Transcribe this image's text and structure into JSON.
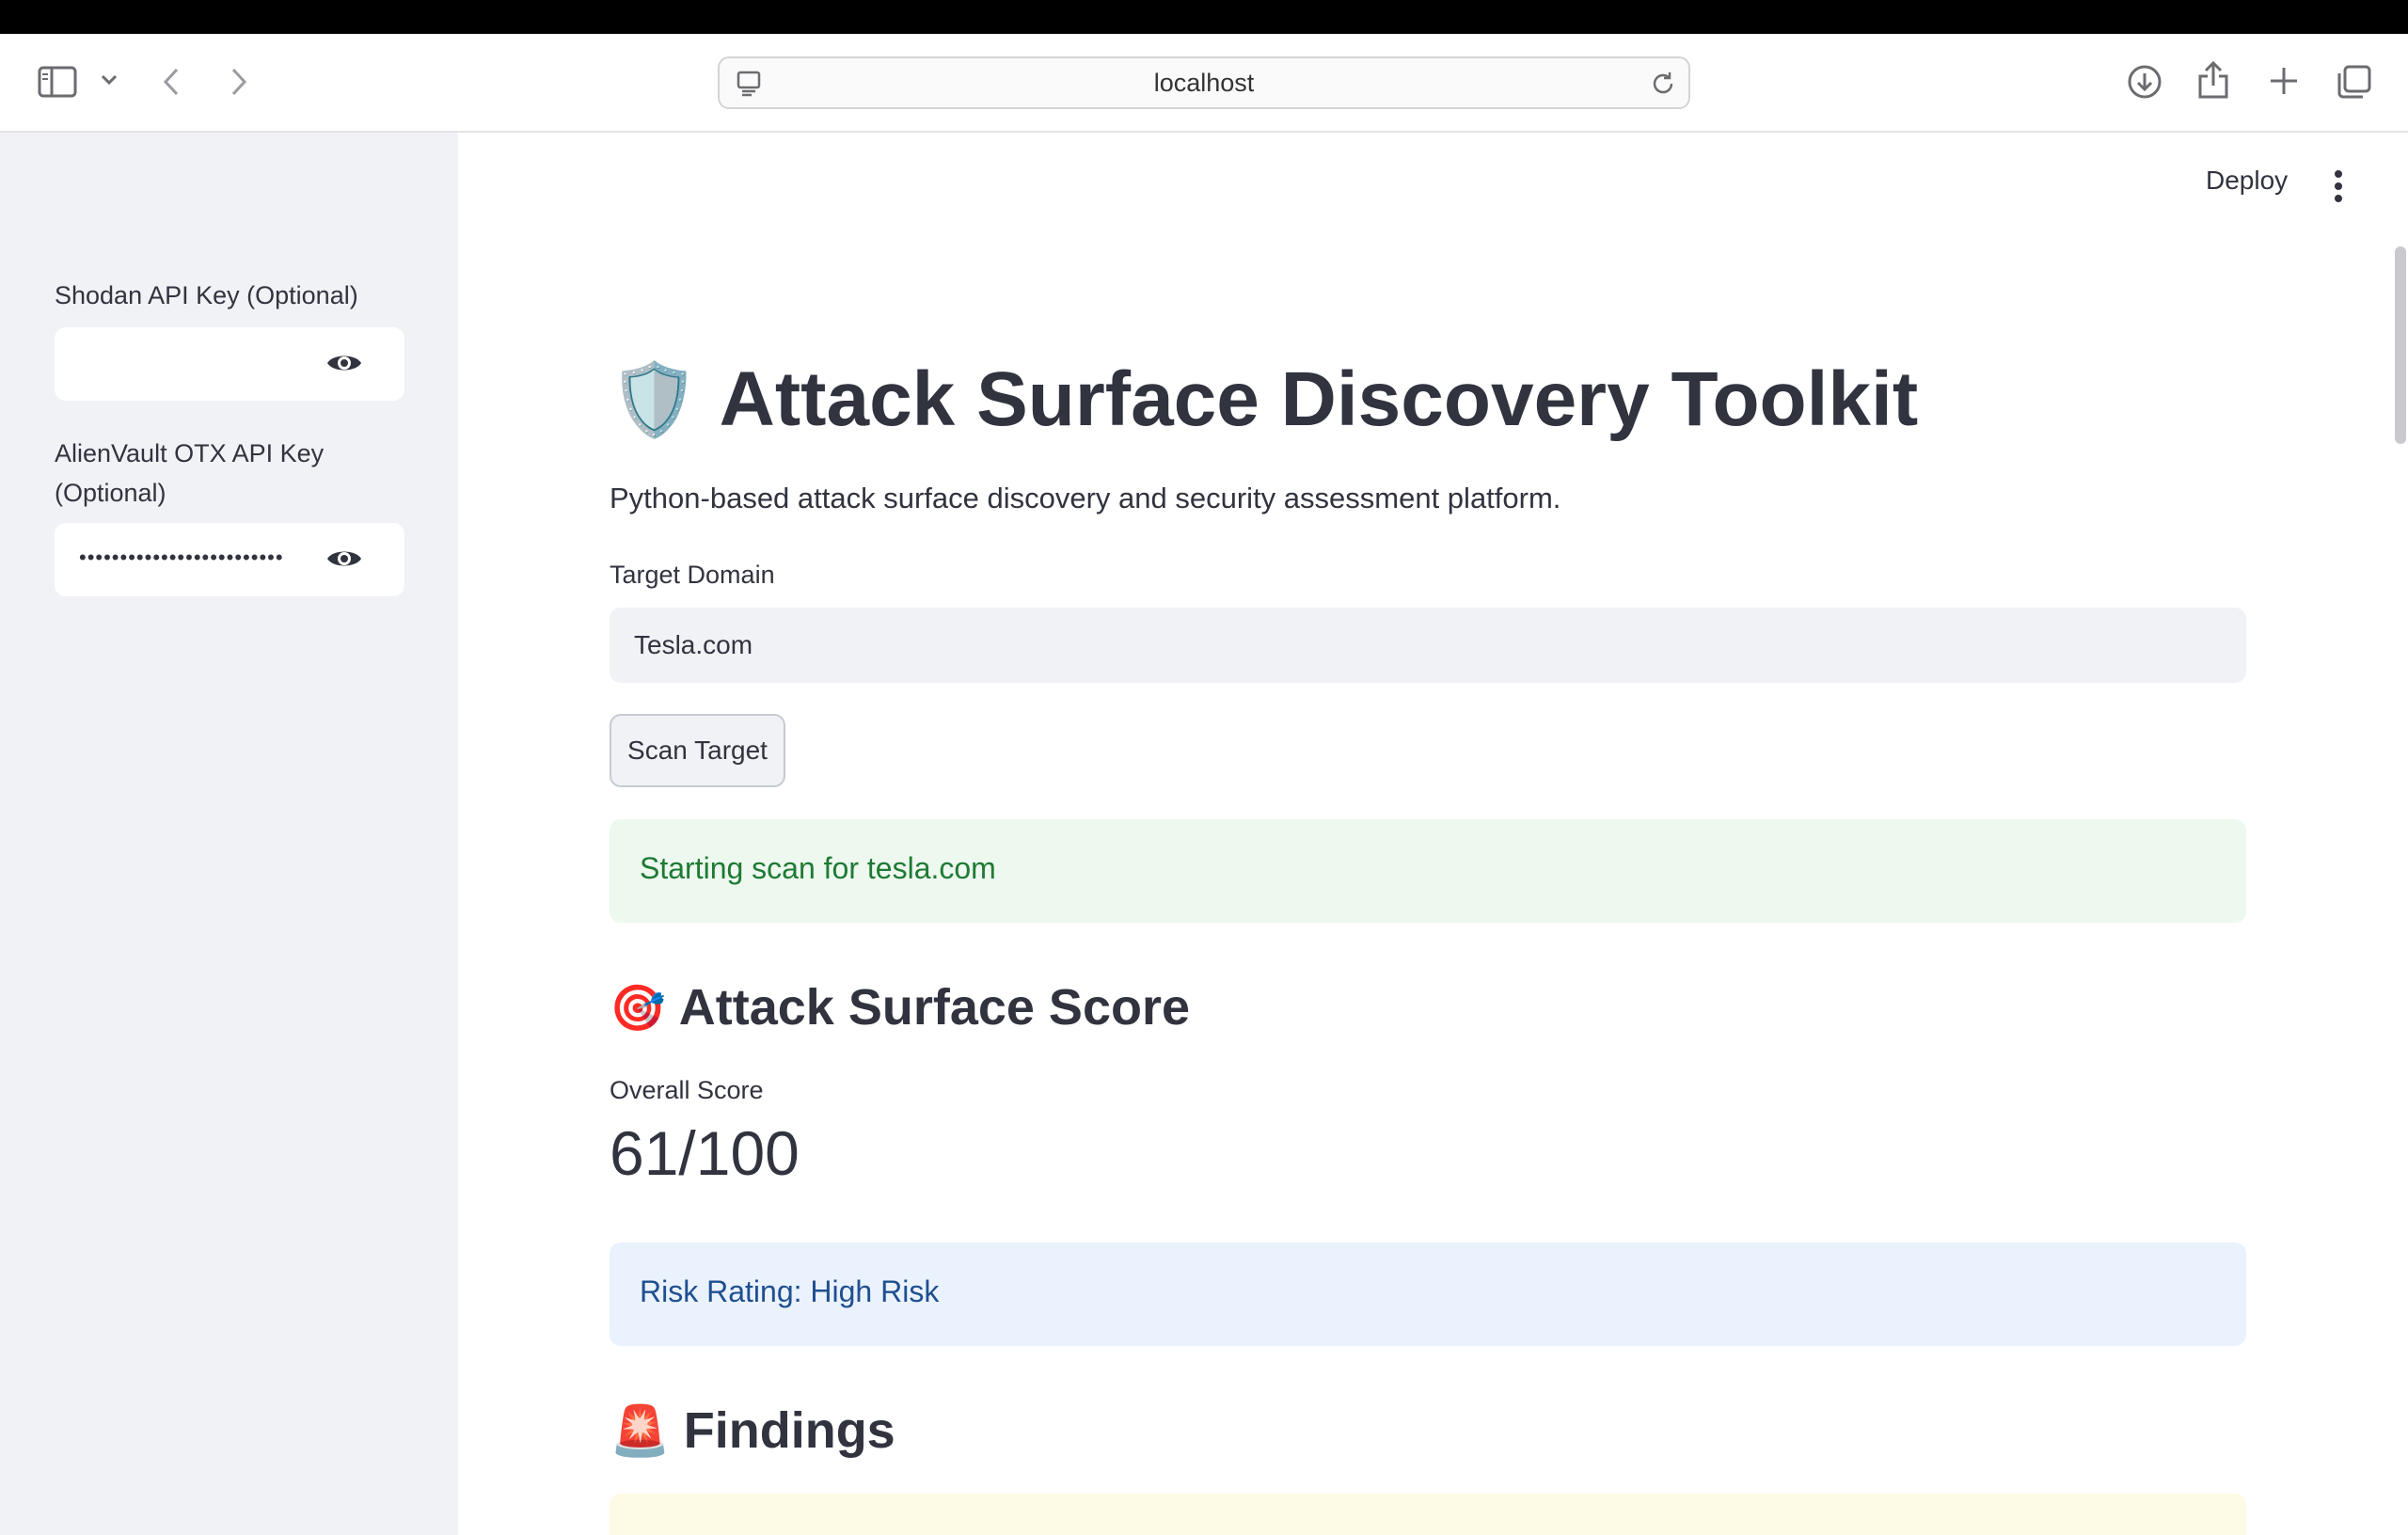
{
  "browser": {
    "url": "localhost",
    "icons": [
      "sidebar-toggle-icon",
      "chevron-down-icon",
      "back-arrow-icon",
      "forward-arrow-icon",
      "site-settings-icon",
      "reload-icon",
      "download-icon",
      "share-icon",
      "new-tab-icon",
      "tab-overview-icon"
    ]
  },
  "sidebar": {
    "shodan": {
      "label": "Shodan API Key (Optional)",
      "value": ""
    },
    "otx": {
      "label_line1": "AlienVault OTX API Key",
      "label_line2": "(Optional)",
      "value": "•••••••••••••••••••••••••"
    }
  },
  "toolbar": {
    "deploy_label": "Deploy"
  },
  "main": {
    "title": "Attack Surface Discovery Toolkit",
    "title_icon": "🛡️",
    "subtitle": "Python-based attack surface discovery and security assessment platform.",
    "target": {
      "label": "Target Domain",
      "value": "Tesla.com"
    },
    "scan_button": "Scan Target",
    "status_message": "Starting scan for tesla.com",
    "score_section": {
      "icon": "🎯",
      "heading": "Attack Surface Score",
      "metric_label": "Overall Score",
      "metric_value": "61/100"
    },
    "risk_message": "Risk Rating: High Risk",
    "findings_section": {
      "icon": "🚨",
      "heading": "Findings"
    }
  },
  "colors": {
    "accent_success": "#1e7a34",
    "accent_info": "#1f4f8f",
    "sidebar_bg": "#f0f2f6"
  }
}
